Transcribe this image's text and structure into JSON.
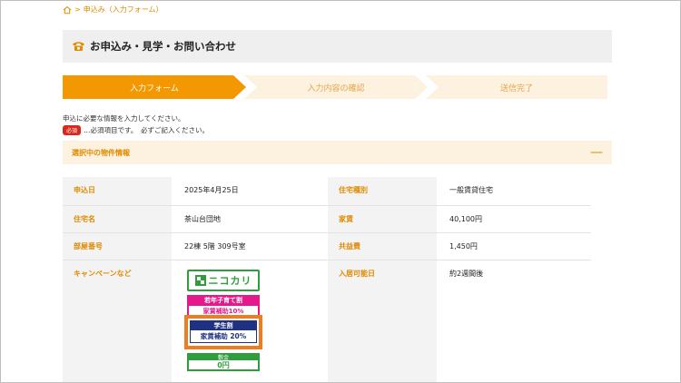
{
  "breadcrumb": {
    "separator": ">",
    "current": "申込み（入力フォーム）"
  },
  "page": {
    "title": "お申込み・見学・お問い合わせ"
  },
  "steps": [
    {
      "label": "入力フォーム",
      "active": true
    },
    {
      "label": "入力内容の確認",
      "active": false
    },
    {
      "label": "送信完了",
      "active": false
    }
  ],
  "instructions": {
    "line1": "申込に必要な情報を入力してください。",
    "required_badge": "必須",
    "line2": "…必須項目です。　必ずご記入ください。"
  },
  "section": {
    "title": "選択中の物件情報",
    "toggle": "—"
  },
  "rows": [
    {
      "label1": "申込日",
      "value1": "2025年4月25日",
      "label2": "住宅種別",
      "value2": "一般賃貸住宅"
    },
    {
      "label1": "住宅名",
      "value1": "茶山台団地",
      "label2": "家賃",
      "value2": "40,100円"
    },
    {
      "label1": "部屋番号",
      "value1": "22棟 5階 309号室",
      "label2": "共益費",
      "value2": "1,450円"
    },
    {
      "label1": "キャンペーンなど",
      "value1": "",
      "label2": "入居可能日",
      "value2": "約2週間後"
    }
  ],
  "campaign": {
    "logo_text": "ニコカリ",
    "young_family": "若年子育て割",
    "young_family_sub": "家賃補助10%",
    "student_title": "学生割",
    "student_value": "家賃補助 20%",
    "green_head": "敷金",
    "green_value": "0円"
  },
  "colors": {
    "accent": "#f39800",
    "step_inactive": "#fdf1df",
    "label": "#e08a00",
    "required": "#d9281c",
    "highlight": "#ed7d1f"
  }
}
